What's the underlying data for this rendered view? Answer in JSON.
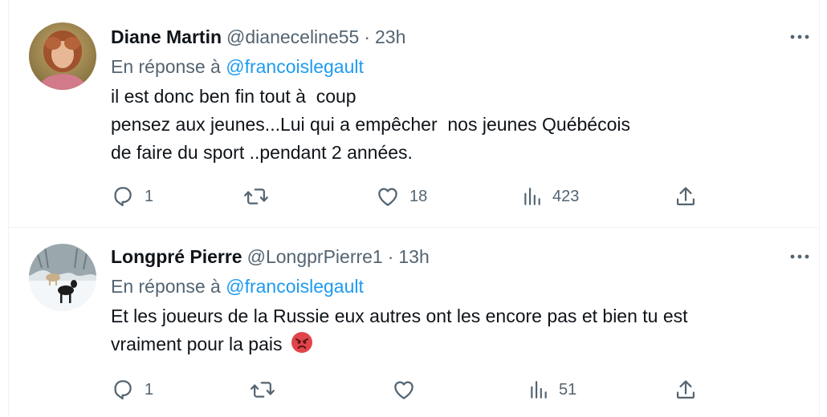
{
  "tweets": [
    {
      "author_name": "Diane Martin",
      "handle": "@dianeceline55",
      "separator": "·",
      "time": "23h",
      "reply_prefix": "En réponse à",
      "reply_handle": "@francoislegault",
      "lines": [
        "il est donc ben fin tout à  coup",
        "pensez aux jeunes...Lui qui a empêcher  nos jeunes Québécois",
        "de faire du sport ..pendant 2 années."
      ],
      "reply_count": "1",
      "retweet_count": "",
      "like_count": "18",
      "view_count": "423",
      "avatar_icon": "woman-portrait-avatar"
    },
    {
      "author_name": "Longpré Pierre",
      "handle": "@LongprPierre1",
      "separator": "·",
      "time": "13h",
      "reply_prefix": "En réponse à",
      "reply_handle": "@francoislegault",
      "lines": [
        "Et les joueurs de la Russie eux autres ont les encore pas et bien tu est",
        "vraiment pour la pais"
      ],
      "emoji": "angry-face-emoji",
      "reply_count": "1",
      "retweet_count": "",
      "like_count": "",
      "view_count": "51",
      "avatar_icon": "dogs-in-snow-avatar"
    }
  ],
  "icons": {
    "more": "more-horizontal-icon",
    "reply": "reply-bubble-icon",
    "retweet": "retweet-icon",
    "like": "heart-icon",
    "views": "views-bar-chart-icon",
    "share": "share-upload-icon"
  },
  "colors": {
    "link": "#1d9bf0",
    "secondary_text": "#536471",
    "primary_text": "#0f1419",
    "border": "#eff3f4"
  }
}
